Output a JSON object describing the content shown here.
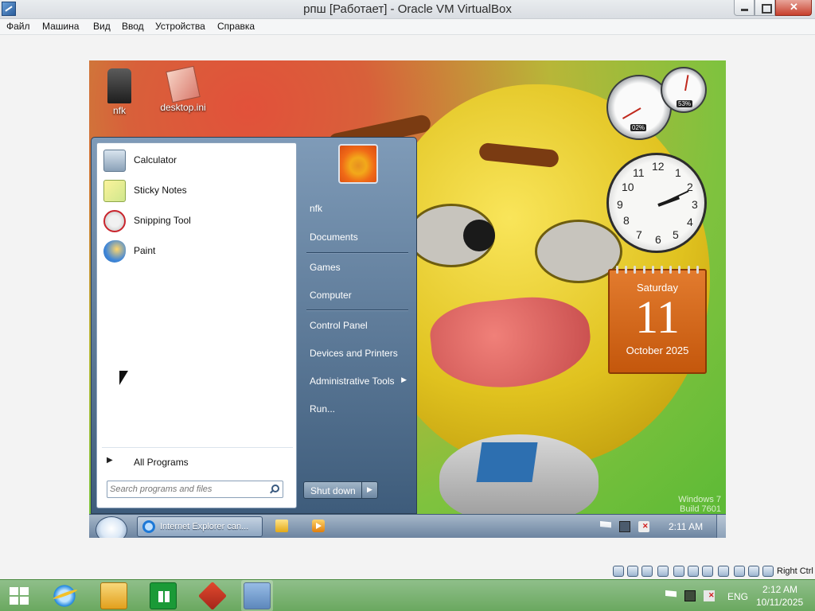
{
  "host_window": {
    "title": "рпш [Работает] - Oracle VM VirtualBox",
    "menu": [
      "Файл",
      "Машина",
      "Вид",
      "Ввод",
      "Устройства",
      "Справка"
    ]
  },
  "guest": {
    "desktop_icons": [
      {
        "label": "nfk",
        "icon": "user-folder-icon"
      },
      {
        "label": "desktop.ini",
        "icon": "ini-file-icon"
      }
    ],
    "gadgets": {
      "cpu_meter": {
        "cpu_readout": "02%",
        "mem_readout": "53%"
      },
      "clock": {
        "numbers": [
          "12",
          "1",
          "2",
          "3",
          "4",
          "5",
          "6",
          "7",
          "8",
          "9",
          "10",
          "11"
        ]
      },
      "calendar": {
        "weekday": "Saturday",
        "day": "11",
        "month_year": "October 2025"
      }
    },
    "watermark": {
      "line1": "Windows 7",
      "line2": "Build 7601"
    },
    "start_menu": {
      "pinned": [
        {
          "label": "Calculator",
          "icon": "calculator-icon"
        },
        {
          "label": "Sticky Notes",
          "icon": "sticky-notes-icon"
        },
        {
          "label": "Snipping Tool",
          "icon": "snipping-tool-icon"
        },
        {
          "label": "Paint",
          "icon": "paint-icon"
        }
      ],
      "all_programs": "All Programs",
      "search_placeholder": "Search programs and files",
      "right_items": [
        "nfk",
        "Documents",
        "Games",
        "Computer",
        "Control Panel",
        "Devices and Printers",
        "Administrative Tools",
        "Run..."
      ],
      "shutdown": "Shut down"
    },
    "taskbar": {
      "ie_task": "Internet Explorer can...",
      "time": "2:11 AM"
    }
  },
  "vbox_status": {
    "host_key": "Right Ctrl"
  },
  "host_taskbar": {
    "apps": [
      "internet-explorer-icon",
      "file-explorer-icon",
      "store-icon",
      "filezilla-icon",
      "virtualbox-icon"
    ],
    "language": "ENG",
    "time": "2:12 AM",
    "date": "10/11/2025"
  },
  "colors": {
    "calendar": "#d8641a",
    "host_taskbar": "#7cb274",
    "guest_taskbar": "#8aa0b8"
  }
}
